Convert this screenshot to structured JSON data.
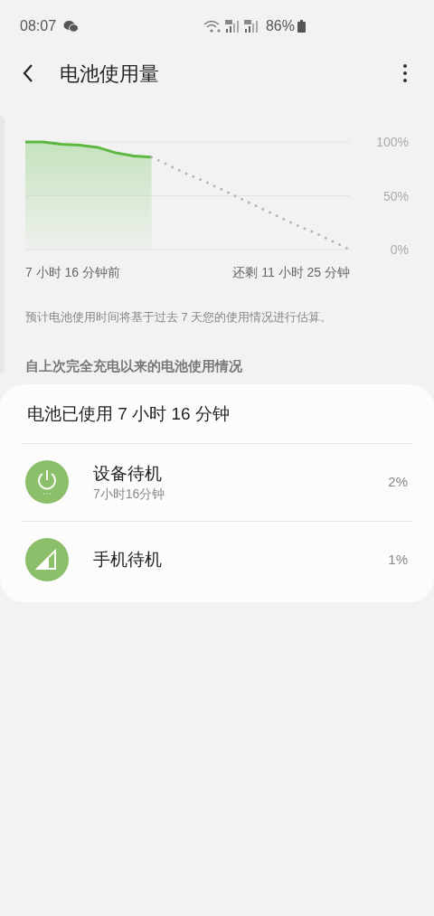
{
  "status_bar": {
    "time": "08:07",
    "battery_percent": "86%"
  },
  "header": {
    "title": "电池使用量"
  },
  "chart": {
    "chart_data": {
      "type": "line",
      "ylim": [
        0,
        100
      ],
      "yticks": [
        {
          "value": 100,
          "label": "100%"
        },
        {
          "value": 50,
          "label": "50%"
        },
        {
          "value": 0,
          "label": "0%"
        }
      ],
      "series": [
        {
          "color": "#5cb840",
          "values": [
            100,
            100,
            98,
            97,
            95,
            90,
            87,
            86,
            null,
            null,
            null,
            null,
            null,
            null,
            null,
            null,
            null,
            null,
            null
          ]
        },
        {
          "color": "#b0b5b8",
          "line_style": "dotted",
          "values": [
            null,
            null,
            null,
            null,
            null,
            null,
            null,
            86,
            78,
            70,
            63,
            55,
            47,
            39,
            31,
            23,
            16,
            8,
            0
          ]
        }
      ]
    },
    "start_label": "7 小时 16 分钟前",
    "end_label": "还剩 11 小时 25 分钟"
  },
  "estimate_note": "预计电池使用时间将基于过去 7 天您的使用情况进行估算。",
  "section_title": "自上次完全充电以来的电池使用情况",
  "usage_card": {
    "title": "电池已使用 7 小时 16 分钟",
    "items": [
      {
        "kind": "power",
        "name": "设备待机",
        "detail": "7小时16分钟",
        "percent": "2%"
      },
      {
        "kind": "signal",
        "name": "手机待机",
        "percent": "1%"
      }
    ]
  }
}
